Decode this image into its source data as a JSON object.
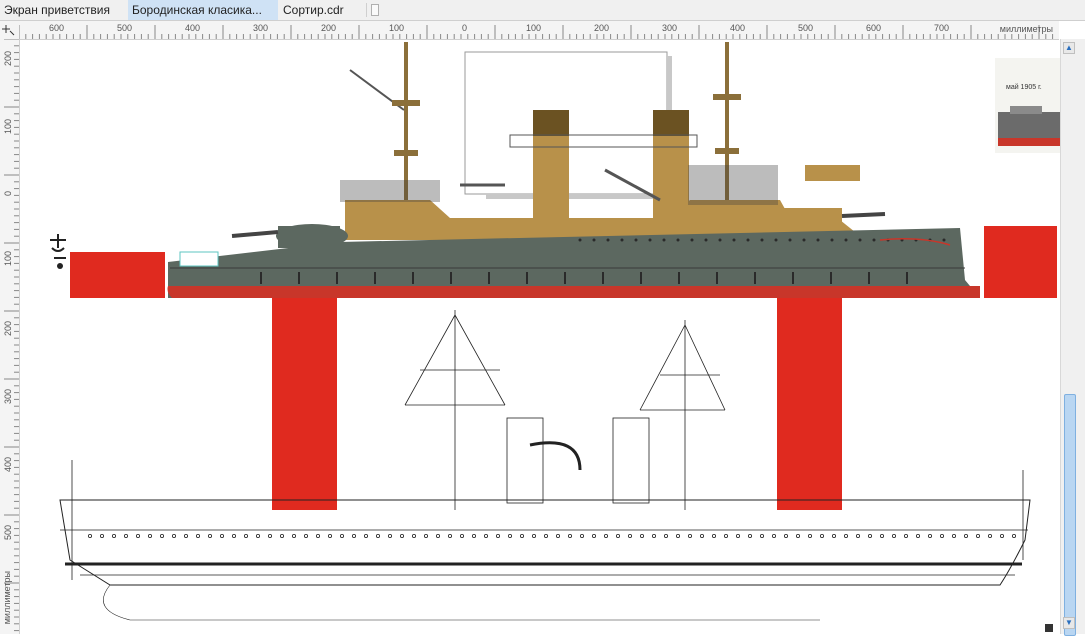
{
  "tabs": [
    {
      "label": "Экран приветствия",
      "active": false
    },
    {
      "label": "Бородинская класика...",
      "active": true
    },
    {
      "label": "Сортир.cdr",
      "active": false
    }
  ],
  "ruler": {
    "units_label": "миллиметры",
    "horizontal_ticks": [
      "600",
      "500",
      "400",
      "300",
      "200",
      "100",
      "0",
      "100",
      "200",
      "300",
      "400",
      "500",
      "600",
      "700"
    ],
    "vertical_ticks": [
      "200",
      "100",
      "0",
      "100",
      "200",
      "300",
      "400",
      "500"
    ],
    "vertical_units_label": "миллиметры"
  },
  "canvas": {
    "thumbnail_caption": "май 1905 г.",
    "hull_color": "#5c6860",
    "superstructure_color": "#b8914a",
    "waterline_color": "#c8362a",
    "block_color": "#e02a1f"
  }
}
